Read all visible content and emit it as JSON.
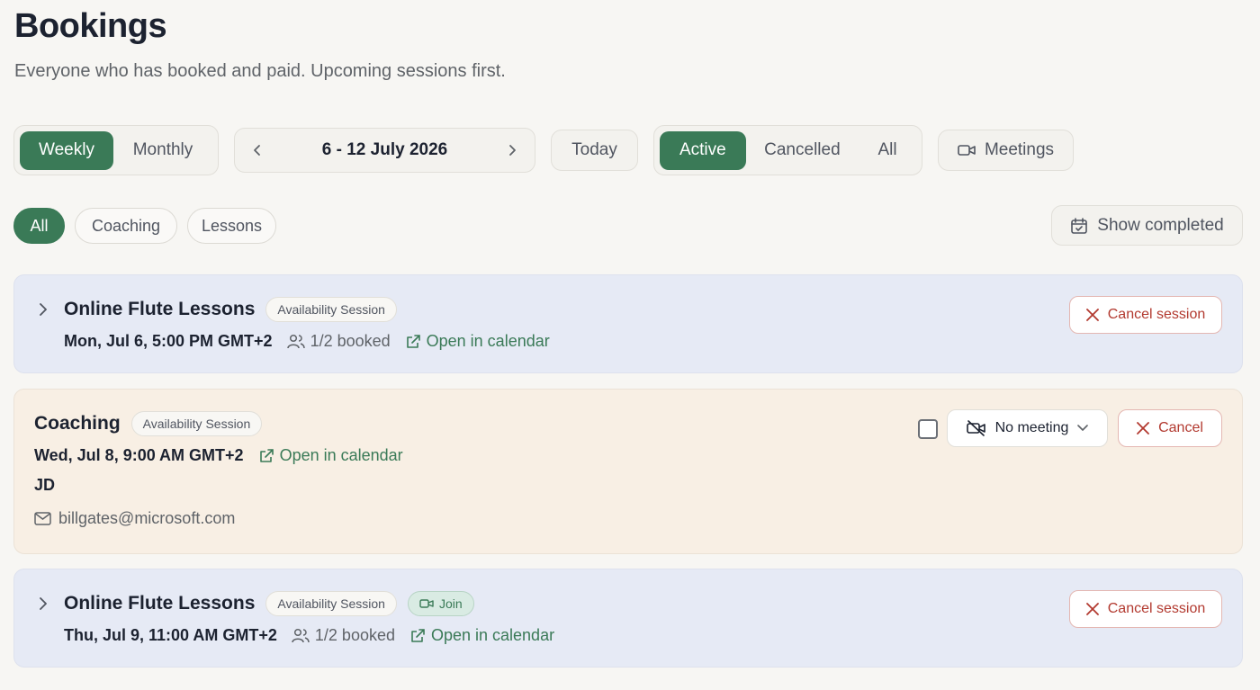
{
  "header": {
    "title": "Bookings",
    "subtitle": "Everyone who has booked and paid. Upcoming sessions first."
  },
  "toolbar": {
    "period_options": [
      "Weekly",
      "Monthly"
    ],
    "period_selected": "Weekly",
    "date_range": "6 - 12 July 2026",
    "today_label": "Today",
    "status_options": [
      "Active",
      "Cancelled",
      "All"
    ],
    "status_selected": "Active",
    "meetings_label": "Meetings"
  },
  "filters": {
    "types": [
      "All",
      "Coaching",
      "Lessons"
    ],
    "type_selected": "All",
    "show_completed_label": "Show completed"
  },
  "sessions": [
    {
      "title": "Online Flute Lessons",
      "badge": "Availability Session",
      "datetime": "Mon, Jul 6, 5:00 PM GMT+2",
      "booked": "1/2 booked",
      "calendar_link": "Open in calendar",
      "cancel_label": "Cancel session"
    },
    {
      "title": "Coaching",
      "badge": "Availability Session",
      "datetime": "Wed, Jul 8, 9:00 AM GMT+2",
      "calendar_link": "Open in calendar",
      "client_initials": "JD",
      "client_email": "billgates@microsoft.com",
      "meeting_select": "No meeting",
      "cancel_label": "Cancel"
    },
    {
      "title": "Online Flute Lessons",
      "badge": "Availability Session",
      "join_label": "Join",
      "datetime": "Thu, Jul 9, 11:00 AM GMT+2",
      "booked": "1/2 booked",
      "calendar_link": "Open in calendar",
      "cancel_label": "Cancel session"
    }
  ],
  "colors": {
    "accent": "#3a7a57",
    "danger": "#b2392f",
    "card_blue": "#e6eaf5",
    "card_peach": "#f8efe4",
    "background": "#f7f6f3"
  }
}
